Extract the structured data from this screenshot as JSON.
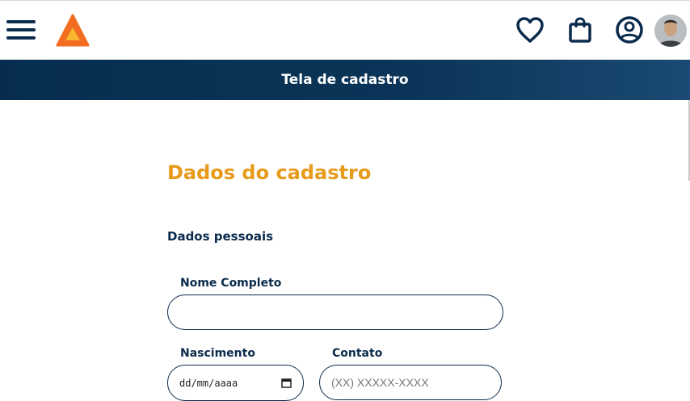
{
  "header": {
    "menu_icon": "hamburger-menu-icon",
    "logo_icon": "triangle-logo-icon",
    "favorites_icon": "heart-icon",
    "cart_icon": "shopping-bag-icon",
    "account_icon": "user-circle-icon",
    "avatar_icon": "profile-photo"
  },
  "banner": {
    "title": "Tela de cadastro"
  },
  "form": {
    "title": "Dados do cadastro",
    "section": "Dados pessoais",
    "full_name": {
      "label": "Nome Completo",
      "value": "",
      "placeholder": ""
    },
    "birth": {
      "label": "Nascimento",
      "value": "dd/mm/aaaa"
    },
    "contact": {
      "label": "Contato",
      "placeholder": "(XX) XXXXX-XXXX"
    }
  },
  "colors": {
    "navy": "#0b2b4c",
    "accent_orange": "#e89a1a",
    "logo_orange": "#f26d21",
    "logo_yellow": "#f7b731"
  }
}
